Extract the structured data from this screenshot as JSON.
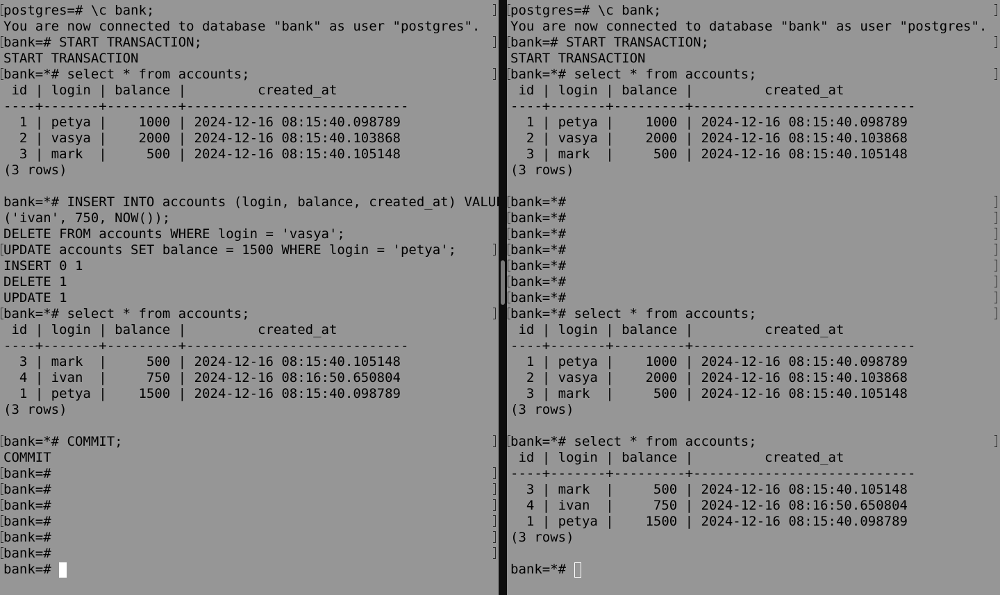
{
  "panes": {
    "left": {
      "lines": [
        {
          "t": "postgres=# \\c bank;",
          "m": true
        },
        {
          "t": "You are now connected to database \"bank\" as user \"postgres\".",
          "m": false
        },
        {
          "t": "bank=# START TRANSACTION;",
          "m": true
        },
        {
          "t": "START TRANSACTION",
          "m": false
        },
        {
          "t": "bank=*# select * from accounts;",
          "m": true
        },
        {
          "t": " id | login | balance |         created_at",
          "m": false
        },
        {
          "t": "----+-------+---------+----------------------------",
          "m": false
        },
        {
          "t": "  1 | petya |    1000 | 2024-12-16 08:15:40.098789",
          "m": false
        },
        {
          "t": "  2 | vasya |    2000 | 2024-12-16 08:15:40.103868",
          "m": false
        },
        {
          "t": "  3 | mark  |     500 | 2024-12-16 08:15:40.105148",
          "m": false
        },
        {
          "t": "(3 rows)",
          "m": false
        },
        {
          "t": "",
          "m": false
        },
        {
          "t": "bank=*# INSERT INTO accounts (login, balance, created_at) VALUES",
          "m": false
        },
        {
          "t": "('ivan', 750, NOW());",
          "m": false
        },
        {
          "t": "DELETE FROM accounts WHERE login = 'vasya';",
          "m": false
        },
        {
          "t": "UPDATE accounts SET balance = 1500 WHERE login = 'petya';",
          "m": true
        },
        {
          "t": "INSERT 0 1",
          "m": false
        },
        {
          "t": "DELETE 1",
          "m": false
        },
        {
          "t": "UPDATE 1",
          "m": false
        },
        {
          "t": "bank=*# select * from accounts;",
          "m": true
        },
        {
          "t": " id | login | balance |         created_at",
          "m": false
        },
        {
          "t": "----+-------+---------+----------------------------",
          "m": false
        },
        {
          "t": "  3 | mark  |     500 | 2024-12-16 08:15:40.105148",
          "m": false
        },
        {
          "t": "  4 | ivan  |     750 | 2024-12-16 08:16:50.650804",
          "m": false
        },
        {
          "t": "  1 | petya |    1500 | 2024-12-16 08:15:40.098789",
          "m": false
        },
        {
          "t": "(3 rows)",
          "m": false
        },
        {
          "t": "",
          "m": false
        },
        {
          "t": "bank=*# COMMIT;",
          "m": true
        },
        {
          "t": "COMMIT",
          "m": false
        },
        {
          "t": "bank=#",
          "m": true
        },
        {
          "t": "bank=#",
          "m": true
        },
        {
          "t": "bank=#",
          "m": true
        },
        {
          "t": "bank=#",
          "m": true
        },
        {
          "t": "bank=#",
          "m": true
        },
        {
          "t": "bank=#",
          "m": true
        }
      ],
      "prompt": "bank=# ",
      "cursor": "block"
    },
    "right": {
      "lines": [
        {
          "t": "postgres=# \\c bank;",
          "m": true
        },
        {
          "t": "You are now connected to database \"bank\" as user \"postgres\".",
          "m": false
        },
        {
          "t": "bank=# START TRANSACTION;",
          "m": true
        },
        {
          "t": "START TRANSACTION",
          "m": false
        },
        {
          "t": "bank=*# select * from accounts;",
          "m": true
        },
        {
          "t": " id | login | balance |         created_at",
          "m": false
        },
        {
          "t": "----+-------+---------+----------------------------",
          "m": false
        },
        {
          "t": "  1 | petya |    1000 | 2024-12-16 08:15:40.098789",
          "m": false
        },
        {
          "t": "  2 | vasya |    2000 | 2024-12-16 08:15:40.103868",
          "m": false
        },
        {
          "t": "  3 | mark  |     500 | 2024-12-16 08:15:40.105148",
          "m": false
        },
        {
          "t": "(3 rows)",
          "m": false
        },
        {
          "t": "",
          "m": false
        },
        {
          "t": "bank=*#",
          "m": true
        },
        {
          "t": "bank=*#",
          "m": true
        },
        {
          "t": "bank=*#",
          "m": true
        },
        {
          "t": "bank=*#",
          "m": true
        },
        {
          "t": "bank=*#",
          "m": true
        },
        {
          "t": "bank=*#",
          "m": true
        },
        {
          "t": "bank=*#",
          "m": true
        },
        {
          "t": "bank=*# select * from accounts;",
          "m": true
        },
        {
          "t": " id | login | balance |         created_at",
          "m": false
        },
        {
          "t": "----+-------+---------+----------------------------",
          "m": false
        },
        {
          "t": "  1 | petya |    1000 | 2024-12-16 08:15:40.098789",
          "m": false
        },
        {
          "t": "  2 | vasya |    2000 | 2024-12-16 08:15:40.103868",
          "m": false
        },
        {
          "t": "  3 | mark  |     500 | 2024-12-16 08:15:40.105148",
          "m": false
        },
        {
          "t": "(3 rows)",
          "m": false
        },
        {
          "t": "",
          "m": false
        },
        {
          "t": "bank=*# select * from accounts;",
          "m": true
        },
        {
          "t": " id | login | balance |         created_at",
          "m": false
        },
        {
          "t": "----+-------+---------+----------------------------",
          "m": false
        },
        {
          "t": "  3 | mark  |     500 | 2024-12-16 08:15:40.105148",
          "m": false
        },
        {
          "t": "  4 | ivan  |     750 | 2024-12-16 08:16:50.650804",
          "m": false
        },
        {
          "t": "  1 | petya |    1500 | 2024-12-16 08:15:40.098789",
          "m": false
        },
        {
          "t": "(3 rows)",
          "m": false
        },
        {
          "t": "",
          "m": false
        }
      ],
      "prompt": "bank=*# ",
      "cursor": "hollow"
    }
  },
  "colors": {
    "background": "#969696",
    "text": "#000000",
    "divider": "#0d0d0d",
    "cursor": "#ffffff"
  }
}
